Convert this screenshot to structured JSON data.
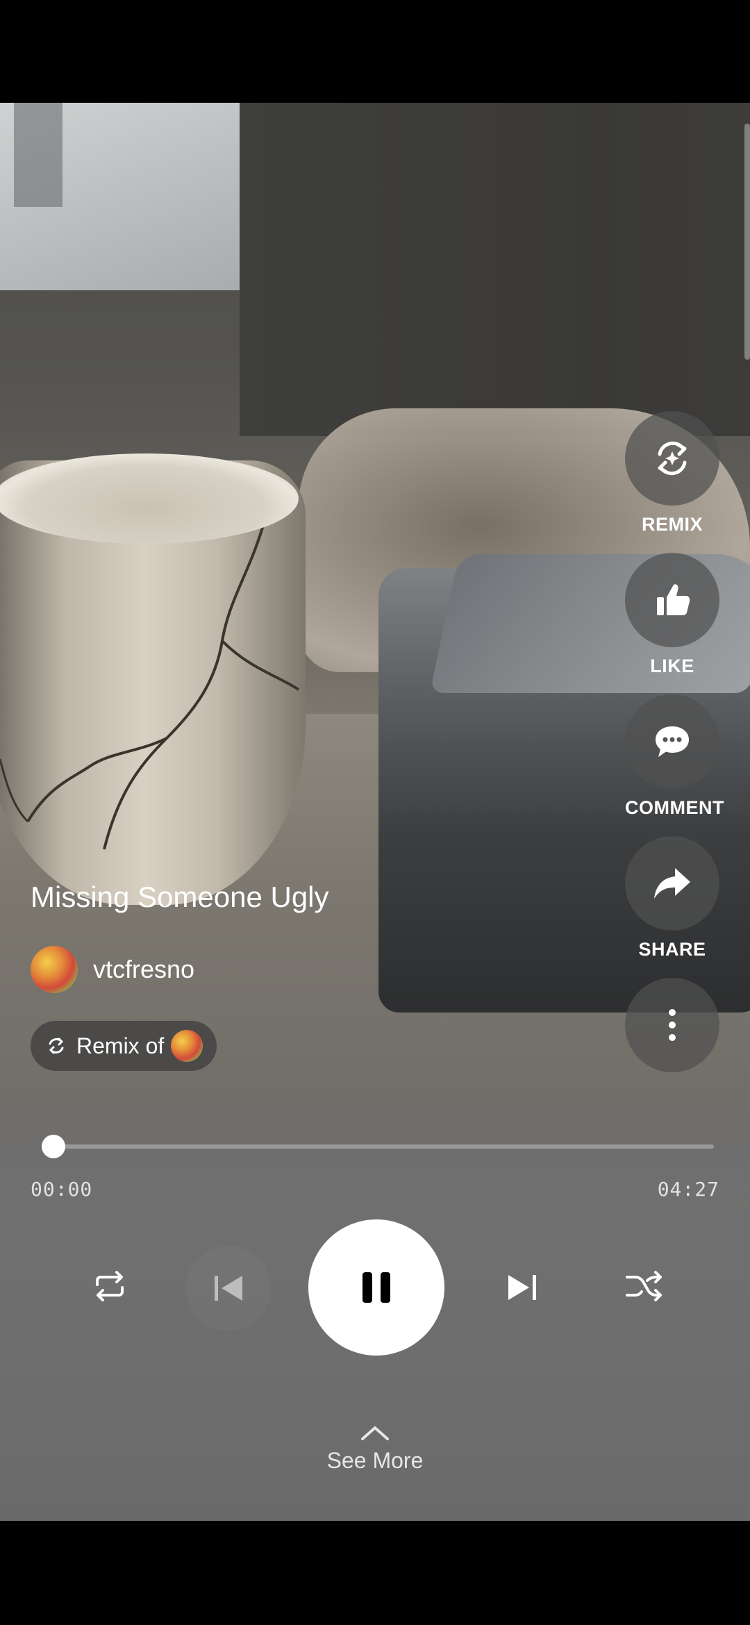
{
  "track": {
    "title": "Missing Someone Ugly",
    "artist": "vtcfresno",
    "remix_label": "Remix of",
    "progress_fraction": 0.0,
    "elapsed": "00:00",
    "duration": "04:27"
  },
  "actions": [
    {
      "id": "remix",
      "label": "REMIX",
      "icon": "remix-sparkle-icon"
    },
    {
      "id": "like",
      "label": "LIKE",
      "icon": "thumbs-up-icon"
    },
    {
      "id": "comment",
      "label": "COMMENT",
      "icon": "comment-bubble-icon"
    },
    {
      "id": "share",
      "label": "SHARE",
      "icon": "share-arrow-icon"
    },
    {
      "id": "more",
      "label": "",
      "icon": "more-vertical-icon"
    }
  ],
  "controls": {
    "repeat_icon": "repeat-icon",
    "previous_icon": "skip-previous-icon",
    "play_pause_icon": "pause-icon",
    "next_icon": "skip-next-icon",
    "shuffle_icon": "shuffle-icon"
  },
  "footer": {
    "see_more": "See More",
    "icon": "chevron-up-icon"
  },
  "colors": {
    "text": "#ffffff",
    "button_bg": "#505050",
    "play_button": "#ffffff"
  }
}
